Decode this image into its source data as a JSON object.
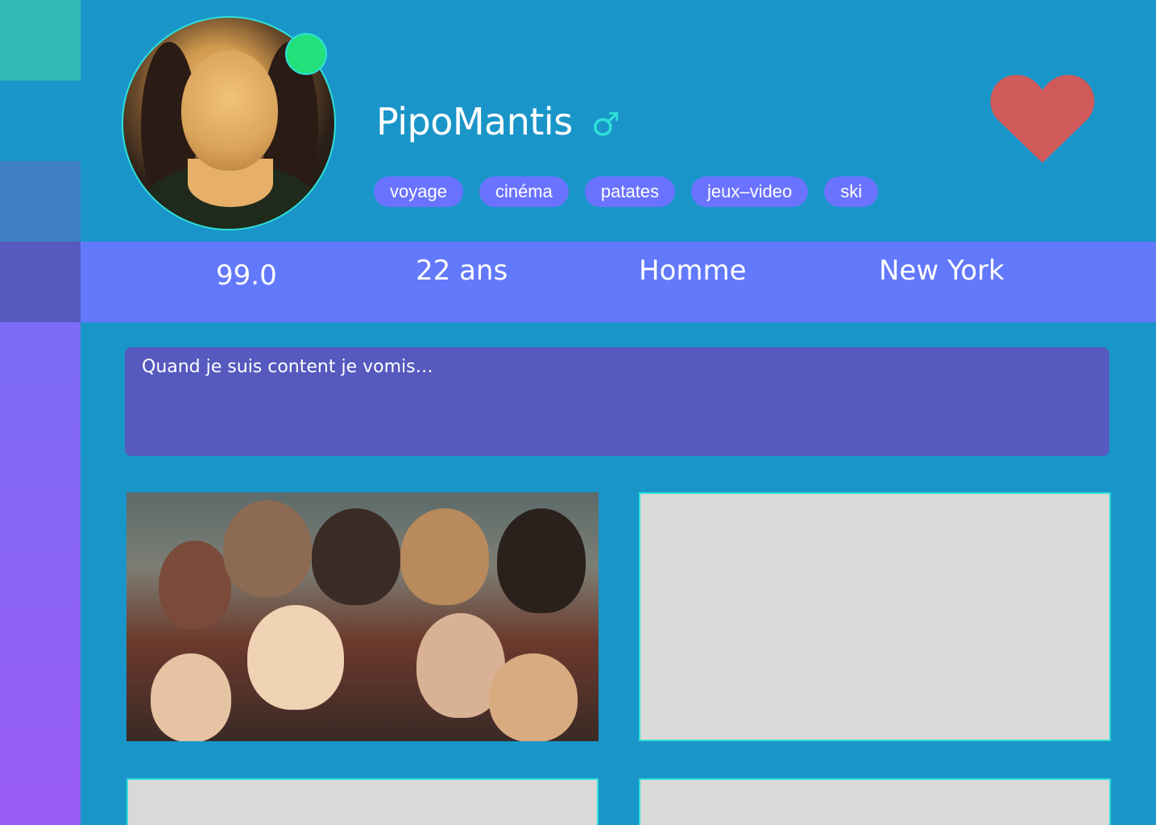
{
  "profile": {
    "username": "PipoMantis",
    "gender_symbol": "♂",
    "online": true,
    "tags": [
      "voyage",
      "cinéma",
      "patates",
      "jeux–video",
      "ski"
    ],
    "liked": true
  },
  "stats": {
    "score": "99.0",
    "age": "22 ans",
    "gender": "Homme",
    "city": "New York"
  },
  "bio": "Quand je suis content je vomis…",
  "colors": {
    "background": "#1a95c9",
    "stats_bar": "#6279fc",
    "bio_box": "#5659be",
    "tag": "#6a73ff",
    "accent": "#2ee0d8",
    "online": "#23e07b",
    "heart": "#d05a5a",
    "sidebar_blocks": [
      "#2fbab5",
      "#1a95c9",
      "#3f7fc2",
      "#5659be"
    ]
  },
  "icons": {
    "online": "online-status-dot",
    "gender": "male-icon",
    "like": "heart-icon"
  }
}
